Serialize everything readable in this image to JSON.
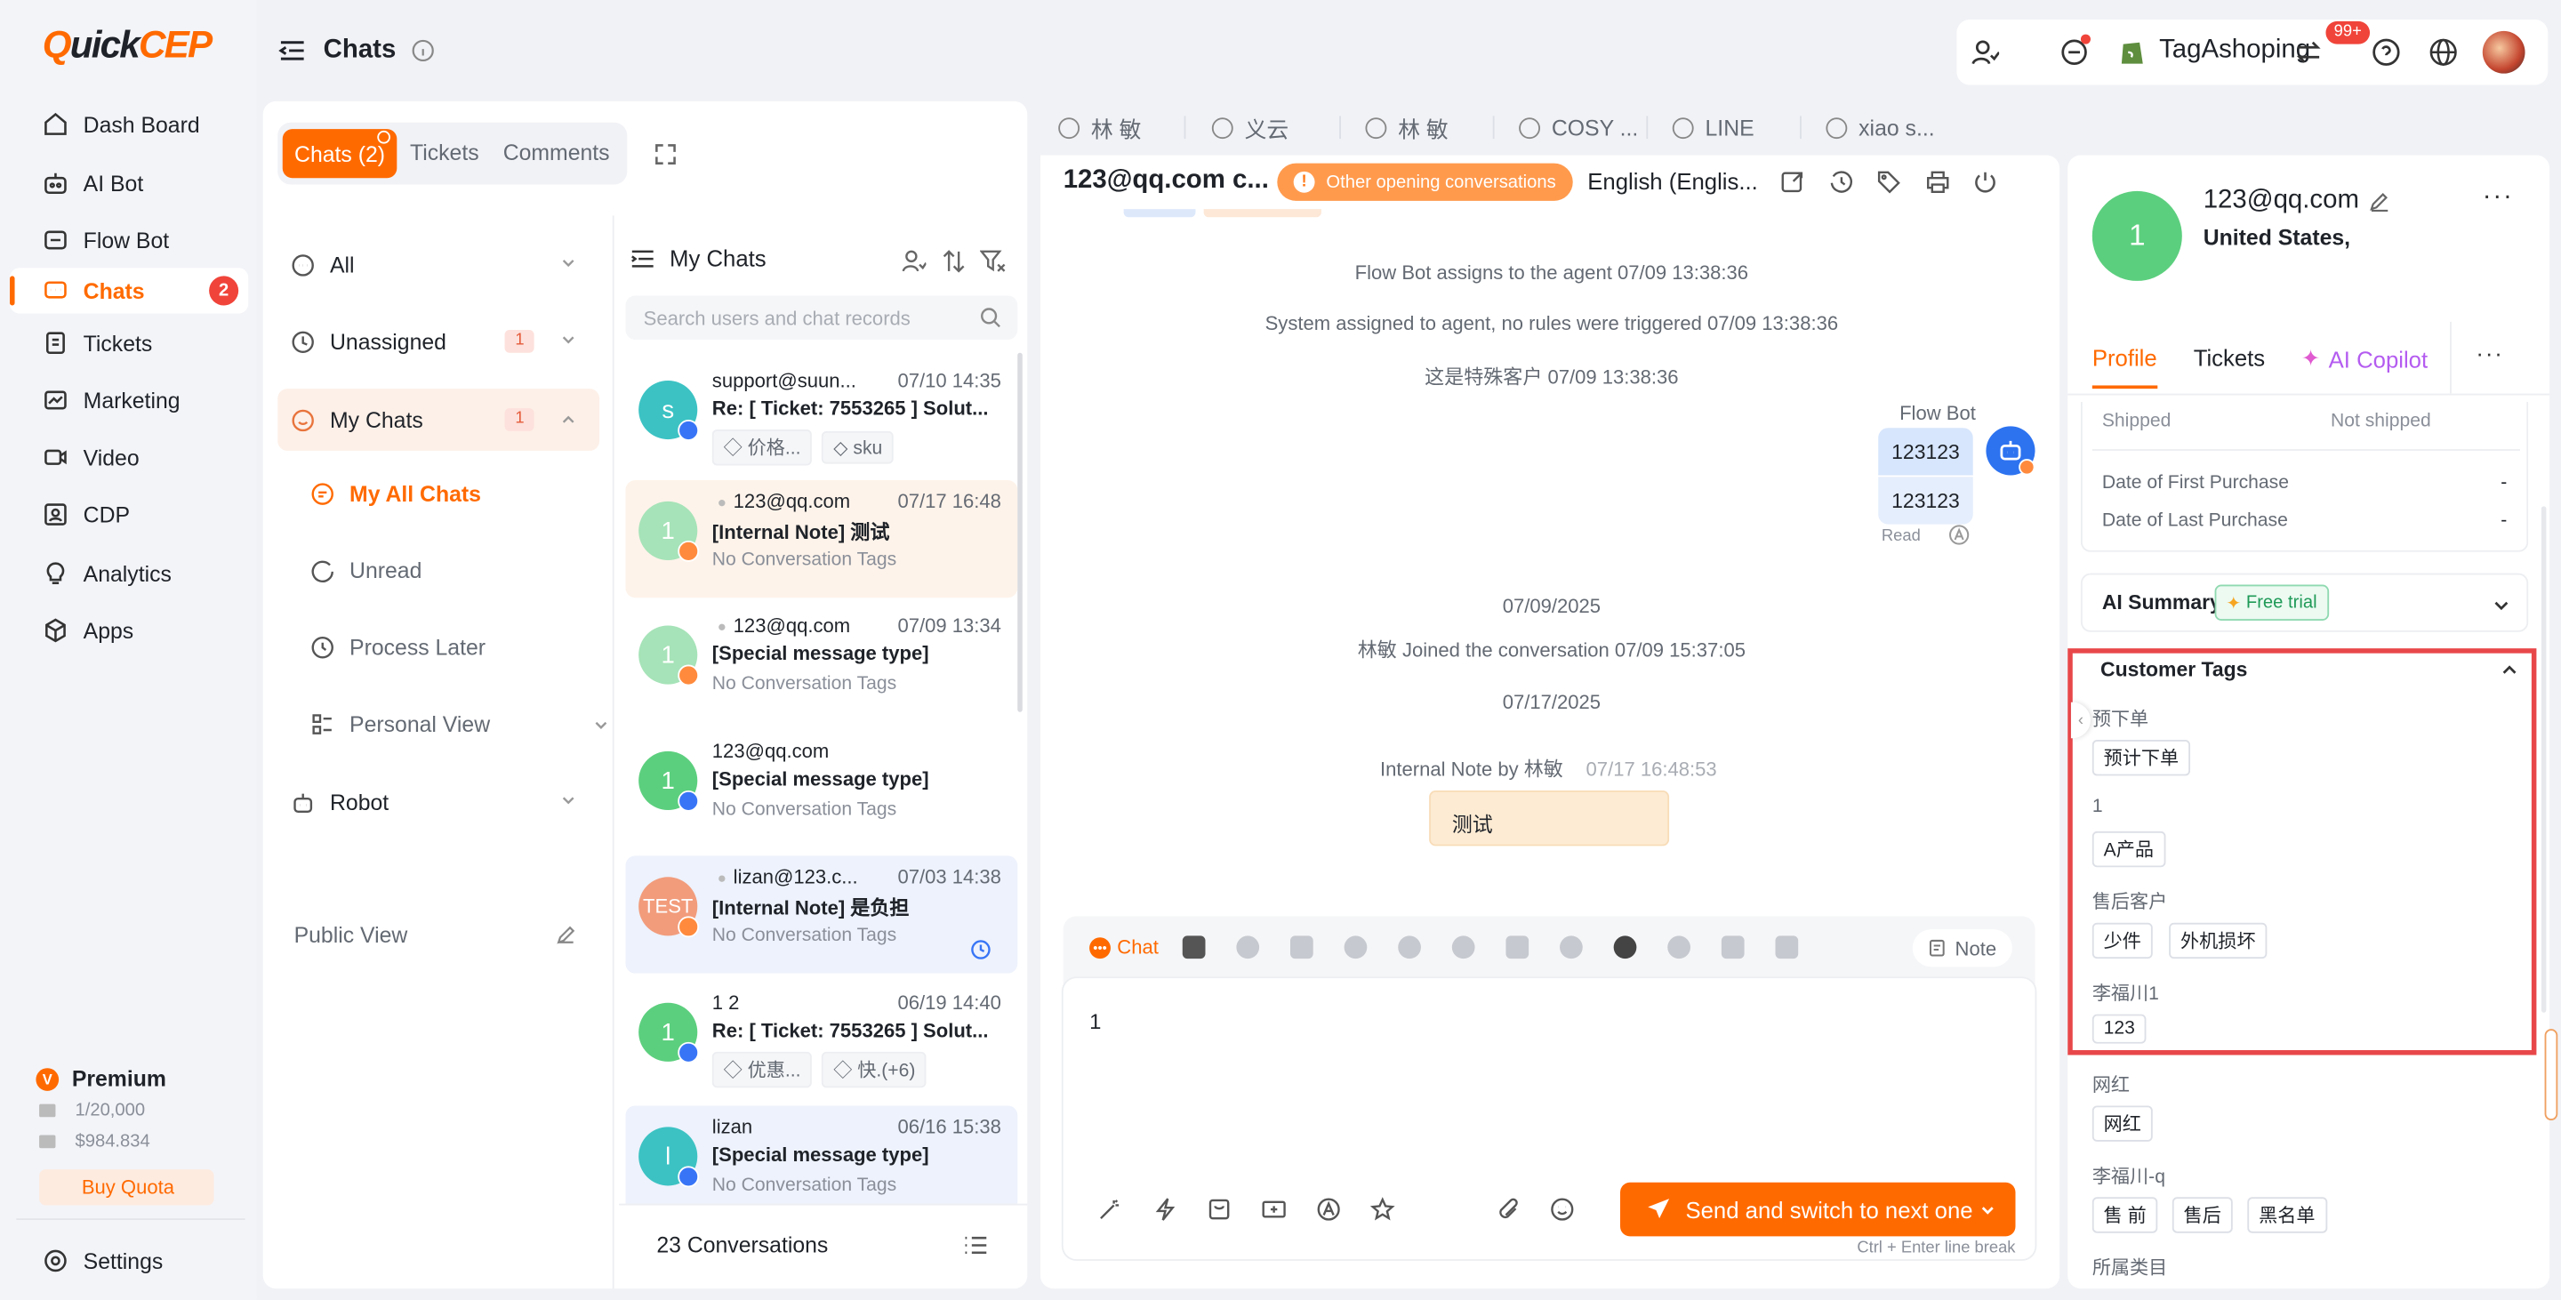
{
  "app": {
    "logo_q": "Q",
    "logo_rest": "uick",
    "logo_cep": "CEP"
  },
  "sidebar": {
    "items": [
      {
        "label": "Dash Board",
        "icon": "dashboard-icon"
      },
      {
        "label": "AI Bot",
        "icon": "ai-bot-icon"
      },
      {
        "label": "Flow Bot",
        "icon": "flow-bot-icon"
      },
      {
        "label": "Chats",
        "icon": "chat-icon",
        "badge": "2"
      },
      {
        "label": "Tickets",
        "icon": "ticket-icon"
      },
      {
        "label": "Marketing",
        "icon": "marketing-icon"
      },
      {
        "label": "Video",
        "icon": "video-icon"
      },
      {
        "label": "CDP",
        "icon": "cdp-icon"
      },
      {
        "label": "Analytics",
        "icon": "analytics-icon"
      },
      {
        "label": "Apps",
        "icon": "apps-icon"
      }
    ],
    "plan": {
      "name": "Premium",
      "quota": "1/20,000",
      "balance": "$984.834",
      "buy": "Buy Quota"
    },
    "settings": "Settings"
  },
  "header": {
    "title": "Chats",
    "store": "TagAshoping",
    "notif_badge": "99+"
  },
  "chat_tabs": {
    "tabs": [
      "Chats (2)",
      "Tickets",
      "Comments"
    ]
  },
  "filters": {
    "all": "All",
    "unassigned": "Unassigned",
    "unassigned_count": "1",
    "my_chats": "My Chats",
    "my_chats_count": "1",
    "my_all_chats": "My All Chats",
    "unread": "Unread",
    "process_later": "Process Later",
    "personal_view": "Personal View",
    "robot": "Robot",
    "public_view": "Public View"
  },
  "list": {
    "title": "My Chats",
    "search_placeholder": "Search users and chat records",
    "footer": "23 Conversations",
    "items": [
      {
        "avatar": "s",
        "name": "support@suun...",
        "time": "07/10 14:35",
        "subject": "Re: [ Ticket: 7553265 ] Solut...",
        "tag1": "价格...",
        "tag2": "sku"
      },
      {
        "avatar": "1",
        "name": "123@qq.com",
        "time": "07/17 16:48",
        "subject": "[Internal Note] 测试",
        "tags": "No Conversation Tags"
      },
      {
        "avatar": "1",
        "name": "123@qq.com",
        "time": "07/09 13:34",
        "subject": "[Special message type]",
        "tags": "No Conversation Tags"
      },
      {
        "avatar": "1",
        "name": "123@qq.com",
        "time": "",
        "subject": "[Special message type]",
        "tags": "No Conversation Tags"
      },
      {
        "avatar": "TEST",
        "name": "lizan@123.c...",
        "time": "07/03 14:38",
        "subject": "[Internal Note] 是负担",
        "tags": "No Conversation Tags"
      },
      {
        "avatar": "1",
        "name": "1 2",
        "time": "06/19 14:40",
        "subject": "Re: [ Ticket: 7553265 ] Solut...",
        "tag1": "优惠...",
        "tag2": "快.(+6)"
      },
      {
        "avatar": "l",
        "name": "lizan",
        "time": "06/16 15:38",
        "subject": "[Special message type]",
        "tags": "No Conversation Tags"
      }
    ]
  },
  "open_tabs": [
    "林 敏",
    "义云",
    "林 敏",
    "COSY ...",
    "LINE",
    "xiao s..."
  ],
  "conversation": {
    "contact": "123@qq.com c...",
    "other_chip": "Other opening conversations",
    "language": "English (Englis...",
    "sys1": "Flow Bot assigns to the agent  07/09 13:38:36",
    "sys2": "System assigned to agent, no rules were triggered  07/09 13:38:36",
    "sys3": "这是特殊客户  07/09 13:38:36",
    "bot_name": "Flow Bot",
    "bubble1": "123123",
    "bubble2": "123123",
    "read": "Read",
    "date1": "07/09/2025",
    "joined": "林敏 Joined the conversation  07/09 15:37:05",
    "date2": "07/17/2025",
    "note_by": "Internal Note by 林敏",
    "note_time": "07/17 16:48:53",
    "note_text": "测试",
    "composer_channel": "Chat",
    "note_btn": "Note",
    "input_value": "1",
    "send": "Send and switch to next one",
    "hint": "Ctrl + Enter line break"
  },
  "profile": {
    "avatar": "1",
    "email": "123@qq.com",
    "country": "United States,",
    "tabs": [
      "Profile",
      "Tickets",
      "AI Copilot"
    ],
    "shipped_label": "Shipped",
    "shipped_value": "Not shipped",
    "first_purchase_label": "Date of First Purchase",
    "first_purchase_value": "-",
    "last_purchase_label": "Date of Last Purchase",
    "last_purchase_value": "-",
    "ai_summary": "AI Summary",
    "free_trial": "Free trial",
    "customer_tags": "Customer Tags",
    "groups": [
      {
        "label": "预下单",
        "tags": [
          "预计下单"
        ]
      },
      {
        "label": "1",
        "tags": [
          "A产品"
        ]
      },
      {
        "label": "售后客户",
        "tags": [
          "少件",
          "外机损坏"
        ]
      },
      {
        "label": "李福川1",
        "tags": [
          "123"
        ]
      },
      {
        "label": "网红",
        "tags": [
          "网红"
        ]
      },
      {
        "label": "李福川-q",
        "tags": [
          "售 前",
          "售后",
          "黑名单"
        ]
      },
      {
        "label": "所属类目",
        "tags": []
      }
    ]
  },
  "colors": {
    "accent": "#ff6a00",
    "highlight_border": "#e8474a"
  }
}
